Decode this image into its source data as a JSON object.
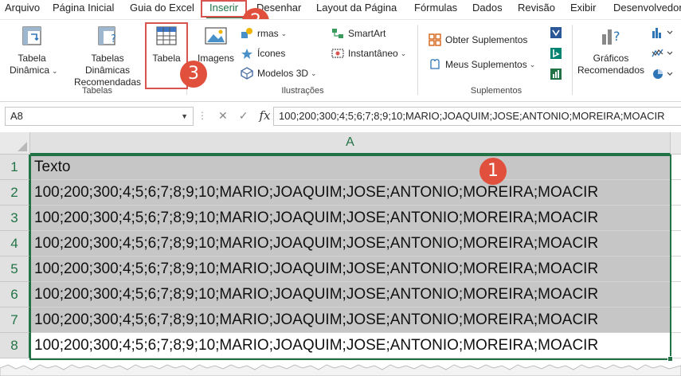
{
  "menu": {
    "tabs": [
      "Arquivo",
      "Página Inicial",
      "Guia do Excel",
      "Inserir",
      "Desenhar",
      "Layout da Página",
      "Fórmulas",
      "Dados",
      "Revisão",
      "Exibir",
      "Desenvolvedor"
    ],
    "active": "Inserir"
  },
  "ribbon": {
    "groups": {
      "tabelas": "Tabelas",
      "ilustracoes": "Ilustrações",
      "suplementos": "Suplementos"
    },
    "buttons": {
      "tabela_dinamica": [
        "Tabela",
        "Dinâmica"
      ],
      "tabelas_dinamicas_recomendadas": [
        "Tabelas Dinâmicas",
        "Recomendadas"
      ],
      "tabela": "Tabela",
      "imagens": "Imagens",
      "formas": "rmas",
      "icones": "Ícones",
      "modelos3d": "Modelos 3D",
      "smartart": "SmartArt",
      "instantaneo": "Instantâneo",
      "obter_suplementos": "Obter Suplementos",
      "meus_suplementos": "Meus Suplementos",
      "graficos_recomendados": [
        "Gráficos",
        "Recomendados"
      ]
    },
    "icons": {
      "tabela_dinamica": "pivot-table-icon",
      "tabelas_dinamicas_recomendadas": "recommended-pivot-icon",
      "tabela": "table-icon",
      "imagens": "picture-icon",
      "icones": "icons-icon",
      "modelos3d": "3d-models-icon",
      "smartart": "smartart-icon",
      "instantaneo": "screenshot-icon",
      "obter_suplementos": "store-icon",
      "meus_suplementos": "my-addins-icon",
      "graficos_recomendados": "recommended-charts-icon"
    }
  },
  "annotations": {
    "badge1": "1",
    "badge2": "2",
    "badge3": "3",
    "color": "#e0503c"
  },
  "formula_bar": {
    "name_box": "A8",
    "formula": "100;200;300;4;5;6;7;8;9;10;MARIO;JOAQUIM;JOSE;ANTONIO;MOREIRA;MOACIR"
  },
  "sheet": {
    "column_header": "A",
    "rows": [
      {
        "num": "1",
        "value": "Texto"
      },
      {
        "num": "2",
        "value": "100;200;300;4;5;6;7;8;9;10;MARIO;JOAQUIM;JOSE;ANTONIO;MOREIRA;MOACIR"
      },
      {
        "num": "3",
        "value": "100;200;300;4;5;6;7;8;9;10;MARIO;JOAQUIM;JOSE;ANTONIO;MOREIRA;MOACIR"
      },
      {
        "num": "4",
        "value": "100;200;300;4;5;6;7;8;9;10;MARIO;JOAQUIM;JOSE;ANTONIO;MOREIRA;MOACIR"
      },
      {
        "num": "5",
        "value": "100;200;300;4;5;6;7;8;9;10;MARIO;JOAQUIM;JOSE;ANTONIO;MOREIRA;MOACIR"
      },
      {
        "num": "6",
        "value": "100;200;300;4;5;6;7;8;9;10;MARIO;JOAQUIM;JOSE;ANTONIO;MOREIRA;MOACIR"
      },
      {
        "num": "7",
        "value": "100;200;300;4;5;6;7;8;9;10;MARIO;JOAQUIM;JOSE;ANTONIO;MOREIRA;MOACIR"
      },
      {
        "num": "8",
        "value": "100;200;300;4;5;6;7;8;9;10;MARIO;JOAQUIM;JOSE;ANTONIO;MOREIRA;MOACIR"
      }
    ]
  },
  "colors": {
    "accent": "#217346",
    "selection": "#c6c6c6",
    "highlight": "#d9534f"
  }
}
